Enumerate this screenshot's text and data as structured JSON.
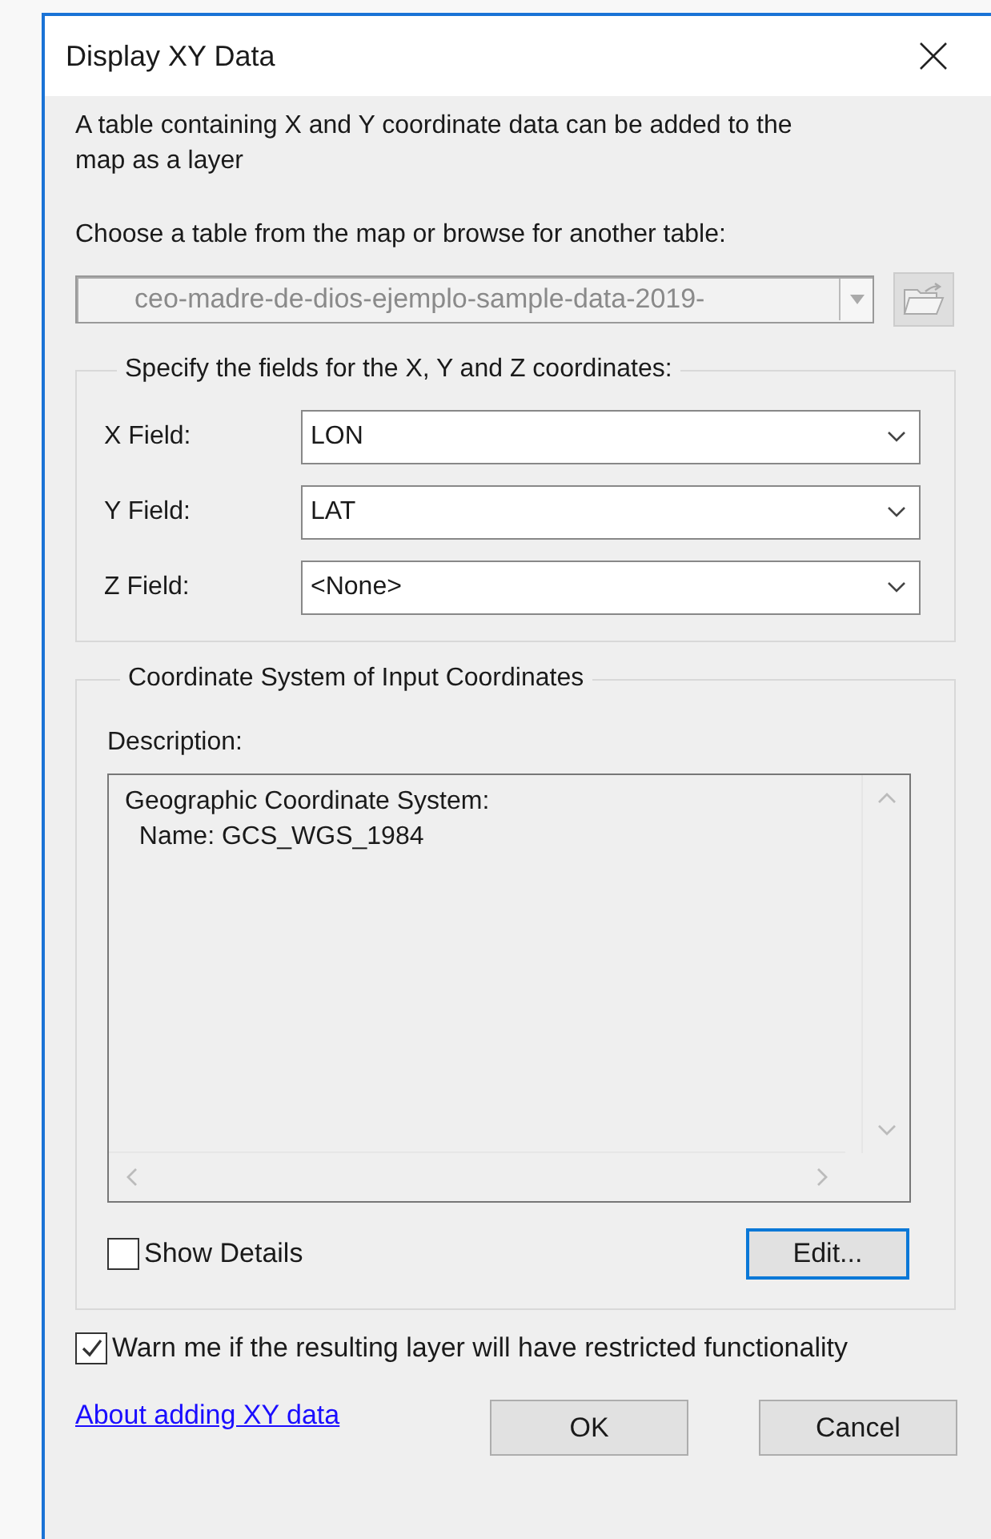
{
  "window": {
    "title": "Display XY Data"
  },
  "intro": "A table containing X and Y coordinate data can be added to the map as a layer",
  "table_prompt": "Choose a table from the map or browse for another table:",
  "table_select": {
    "value": "ceo-madre-de-dios-ejemplo-sample-data-2019-",
    "disabled": true
  },
  "fields_group": {
    "legend": "Specify the fields for the X, Y and Z coordinates:",
    "fields": [
      {
        "label": "X Field:",
        "value": "LON"
      },
      {
        "label": "Y Field:",
        "value": "LAT"
      },
      {
        "label": "Z Field:",
        "value": "<None>"
      }
    ]
  },
  "coordinate_group": {
    "legend": "Coordinate System of Input Coordinates",
    "description_label": "Description:",
    "description_lines": [
      "Geographic Coordinate System:",
      "  Name: GCS_WGS_1984"
    ],
    "show_details": {
      "label": "Show Details",
      "checked": false
    },
    "edit_button": "Edit..."
  },
  "warn": {
    "label": "Warn me if the resulting layer will have restricted functionality",
    "checked": true
  },
  "help_link": "About adding XY data",
  "buttons": [
    "OK",
    "Cancel"
  ]
}
